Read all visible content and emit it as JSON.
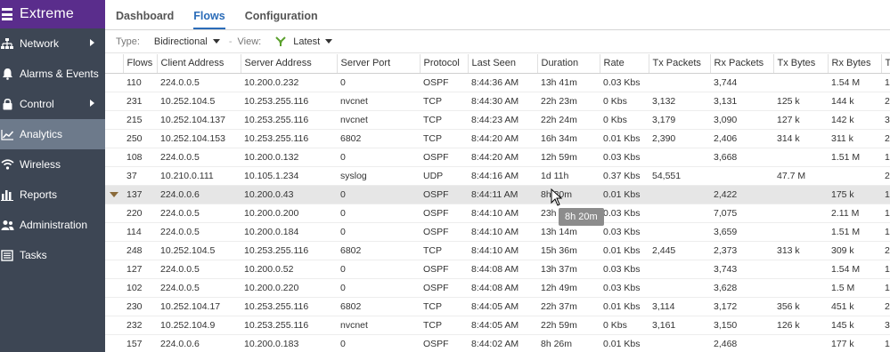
{
  "brand": {
    "name": "Extreme"
  },
  "sidebar": {
    "items": [
      {
        "label": "Network",
        "icon": "network-icon",
        "has_submenu": true,
        "active": false
      },
      {
        "label": "Alarms & Events",
        "icon": "bell-icon",
        "has_submenu": false,
        "active": false
      },
      {
        "label": "Control",
        "icon": "lock-icon",
        "has_submenu": true,
        "active": false
      },
      {
        "label": "Analytics",
        "icon": "line-chart-icon",
        "has_submenu": false,
        "active": true
      },
      {
        "label": "Wireless",
        "icon": "wifi-icon",
        "has_submenu": false,
        "active": false
      },
      {
        "label": "Reports",
        "icon": "bar-chart-icon",
        "has_submenu": false,
        "active": false
      },
      {
        "label": "Administration",
        "icon": "users-icon",
        "has_submenu": false,
        "active": false
      },
      {
        "label": "Tasks",
        "icon": "tasks-icon",
        "has_submenu": false,
        "active": false
      }
    ]
  },
  "tabs": [
    {
      "label": "Dashboard",
      "active": false
    },
    {
      "label": "Flows",
      "active": true
    },
    {
      "label": "Configuration",
      "active": false
    }
  ],
  "toolbar": {
    "type_label": "Type:",
    "type_value": "Bidirectional",
    "view_label": "View:",
    "view_value": "Latest"
  },
  "table": {
    "columns": [
      "Flows",
      "Client Address",
      "Server Address",
      "Server Port",
      "Protocol",
      "Last Seen",
      "Duration",
      "Rate",
      "Tx Packets",
      "Rx Packets",
      "Tx Bytes",
      "Rx Bytes",
      "T"
    ],
    "rows": [
      [
        "110",
        "224.0.0.5",
        "10.200.0.232",
        "0",
        "OSPF",
        "8:44:36 AM",
        "13h 41m",
        "0.03 Kbs",
        "",
        "3,744",
        "",
        "1.54 M",
        "1"
      ],
      [
        "231",
        "10.252.104.5",
        "10.253.255.116",
        "nvcnet",
        "TCP",
        "8:44:30 AM",
        "22h 23m",
        "0 Kbs",
        "3,132",
        "3,131",
        "125 k",
        "144 k",
        "2"
      ],
      [
        "215",
        "10.252.104.137",
        "10.253.255.116",
        "nvcnet",
        "TCP",
        "8:44:23 AM",
        "22h 24m",
        "0 Kbs",
        "3,179",
        "3,090",
        "127 k",
        "142 k",
        "3"
      ],
      [
        "250",
        "10.252.104.153",
        "10.253.255.116",
        "6802",
        "TCP",
        "8:44:20 AM",
        "16h 34m",
        "0.01 Kbs",
        "2,390",
        "2,406",
        "314 k",
        "311 k",
        "2"
      ],
      [
        "108",
        "224.0.0.5",
        "10.200.0.132",
        "0",
        "OSPF",
        "8:44:20 AM",
        "12h 59m",
        "0.03 Kbs",
        "",
        "3,668",
        "",
        "1.51 M",
        "1"
      ],
      [
        "37",
        "10.210.0.111",
        "10.105.1.234",
        "syslog",
        "UDP",
        "8:44:16 AM",
        "1d 11h",
        "0.37 Kbs",
        "54,551",
        "",
        "47.7 M",
        "",
        "2"
      ],
      [
        "137",
        "224.0.0.6",
        "10.200.0.43",
        "0",
        "OSPF",
        "8:44:11 AM",
        "8h 20m",
        "0.01 Kbs",
        "",
        "2,422",
        "",
        "175 k",
        "1"
      ],
      [
        "220",
        "224.0.0.5",
        "10.200.0.200",
        "0",
        "OSPF",
        "8:44:10 AM",
        "23h 37m",
        "0.03 Kbs",
        "",
        "7,075",
        "",
        "2.11 M",
        "1"
      ],
      [
        "114",
        "224.0.0.5",
        "10.200.0.184",
        "0",
        "OSPF",
        "8:44:10 AM",
        "13h 14m",
        "0.03 Kbs",
        "",
        "3,659",
        "",
        "1.51 M",
        "1"
      ],
      [
        "248",
        "10.252.104.5",
        "10.253.255.116",
        "6802",
        "TCP",
        "8:44:10 AM",
        "15h 36m",
        "0.01 Kbs",
        "2,445",
        "2,373",
        "313 k",
        "309 k",
        "2"
      ],
      [
        "127",
        "224.0.0.5",
        "10.200.0.52",
        "0",
        "OSPF",
        "8:44:08 AM",
        "13h 37m",
        "0.03 Kbs",
        "",
        "3,743",
        "",
        "1.54 M",
        "1"
      ],
      [
        "102",
        "224.0.0.5",
        "10.200.0.220",
        "0",
        "OSPF",
        "8:44:08 AM",
        "12h 49m",
        "0.03 Kbs",
        "",
        "3,628",
        "",
        "1.5 M",
        "1"
      ],
      [
        "230",
        "10.252.104.17",
        "10.253.255.116",
        "6802",
        "TCP",
        "8:44:05 AM",
        "22h 37m",
        "0.01 Kbs",
        "3,114",
        "3,172",
        "356 k",
        "451 k",
        "2"
      ],
      [
        "232",
        "10.252.104.9",
        "10.253.255.116",
        "nvcnet",
        "TCP",
        "8:44:05 AM",
        "22h 59m",
        "0 Kbs",
        "3,161",
        "3,150",
        "126 k",
        "145 k",
        "3"
      ],
      [
        "157",
        "224.0.0.6",
        "10.200.0.183",
        "0",
        "OSPF",
        "8:44:02 AM",
        "8h 26m",
        "0.01 Kbs",
        "",
        "2,468",
        "",
        "177 k",
        "1"
      ]
    ],
    "selected_row": 6
  },
  "tooltip": {
    "text": "8h 20m"
  },
  "colors": {
    "sidebar_bg": "#3d4654",
    "brand_bg": "#5a2d8c",
    "active_item": "#6d7a8b",
    "accent": "#2b6cb8"
  }
}
